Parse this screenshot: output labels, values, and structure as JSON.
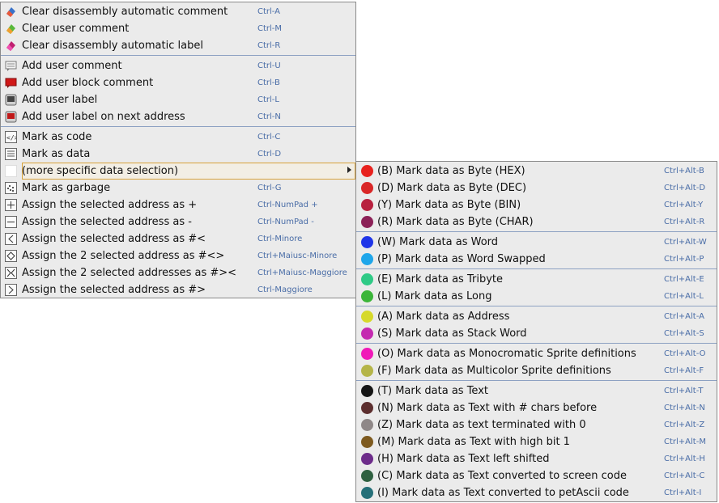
{
  "main_menu": {
    "items": [
      {
        "label": "Clear disassembly automatic comment",
        "shortcut": "Ctrl-A",
        "icon": "eraser-icon",
        "icon_colors": [
          "#e8593a",
          "#3a72c9"
        ]
      },
      {
        "label": "Clear user comment",
        "shortcut": "Ctrl-M",
        "icon": "eraser-icon",
        "icon_colors": [
          "#f0a030",
          "#58b83a"
        ]
      },
      {
        "label": "Clear disassembly automatic label",
        "shortcut": "Ctrl-R",
        "icon": "eraser-icon",
        "icon_colors": [
          "#e0309a",
          "#c02070"
        ]
      },
      {
        "label": "Add user comment",
        "shortcut": "Ctrl-U",
        "icon": "comment-icon",
        "icon_colors": [
          "#808080"
        ]
      },
      {
        "label": "Add user block comment",
        "shortcut": "Ctrl-B",
        "icon": "block-comment-icon",
        "icon_colors": [
          "#d01818"
        ]
      },
      {
        "label": "Add user label",
        "shortcut": "Ctrl-L",
        "icon": "label-icon",
        "icon_colors": [
          "#555555"
        ]
      },
      {
        "label": "Add user label on next address",
        "shortcut": "Ctrl-N",
        "icon": "next-label-icon",
        "icon_colors": [
          "#c01818"
        ]
      },
      {
        "label": "Mark as code",
        "shortcut": "Ctrl-C",
        "icon": "code-icon",
        "icon_colors": []
      },
      {
        "label": "Mark as data",
        "shortcut": "Ctrl-D",
        "icon": "data-icon",
        "icon_colors": []
      },
      {
        "label": "(more specific data selection)",
        "shortcut": "",
        "icon": "blank-icon",
        "icon_colors": []
      },
      {
        "label": "Mark as garbage",
        "shortcut": "Ctrl-G",
        "icon": "garbage-icon",
        "icon_colors": []
      },
      {
        "label": "Assign the selected address as +",
        "shortcut": "Ctrl-NumPad +",
        "icon": "plus-doc-icon",
        "icon_colors": []
      },
      {
        "label": "Assign the selected address as -",
        "shortcut": "Ctrl-NumPad -",
        "icon": "minus-doc-icon",
        "icon_colors": []
      },
      {
        "label": "Assign the selected address as #<",
        "shortcut": "Ctrl-Minore",
        "icon": "less-doc-icon",
        "icon_colors": []
      },
      {
        "label": "Assign the 2 selected address as #<>",
        "shortcut": "Ctrl+Maiusc-Minore",
        "icon": "diamond-doc-icon",
        "icon_colors": []
      },
      {
        "label": "Assign the 2 selected addresses as #><",
        "shortcut": "Ctrl+Maiusc-Maggiore",
        "icon": "cross-doc-icon",
        "icon_colors": []
      },
      {
        "label": "Assign the selected address as #>",
        "shortcut": "Ctrl-Maggiore",
        "icon": "greater-doc-icon",
        "icon_colors": []
      }
    ]
  },
  "sub_menu": {
    "items": [
      {
        "label": "(B) Mark data as Byte (HEX)",
        "shortcut": "Ctrl+Alt-B",
        "color": "#e8221e"
      },
      {
        "label": "(D) Mark data as Byte (DEC)",
        "shortcut": "Ctrl+Alt-D",
        "color": "#d92626"
      },
      {
        "label": "(Y) Mark data as Byte (BIN)",
        "shortcut": "Ctrl+Alt-Y",
        "color": "#b8213f"
      },
      {
        "label": "(R) Mark data as Byte (CHAR)",
        "shortcut": "Ctrl+Alt-R",
        "color": "#8c2157"
      },
      {
        "label": "(W) Mark data as Word",
        "shortcut": "Ctrl+Alt-W",
        "color": "#1f35e8"
      },
      {
        "label": "(P) Mark data as Word Swapped",
        "shortcut": "Ctrl+Alt-P",
        "color": "#1ea6ea"
      },
      {
        "label": "(E) Mark data as Tribyte",
        "shortcut": "Ctrl+Alt-E",
        "color": "#2fca86"
      },
      {
        "label": "(L) Mark data as Long",
        "shortcut": "Ctrl+Alt-L",
        "color": "#3bb539"
      },
      {
        "label": "(A) Mark data as Address",
        "shortcut": "Ctrl+Alt-A",
        "color": "#d6d92a"
      },
      {
        "label": "(S) Mark data as Stack Word",
        "shortcut": "Ctrl+Alt-S",
        "color": "#c42ab0"
      },
      {
        "label": "(O) Mark data as Monocromatic Sprite definitions",
        "shortcut": "Ctrl+Alt-O",
        "color": "#f01ab8"
      },
      {
        "label": "(F) Mark data as Multicolor Sprite definitions",
        "shortcut": "Ctrl+Alt-F",
        "color": "#b5b548"
      },
      {
        "label": "(T) Mark data as Text",
        "shortcut": "Ctrl+Alt-T",
        "color": "#151515"
      },
      {
        "label": "(N) Mark data as Text with # chars before",
        "shortcut": "Ctrl+Alt-N",
        "color": "#5c2e2e"
      },
      {
        "label": "(Z) Mark data as text terminated with 0",
        "shortcut": "Ctrl+Alt-Z",
        "color": "#8f8888"
      },
      {
        "label": "(M) Mark data as Text with high bit 1",
        "shortcut": "Ctrl+Alt-M",
        "color": "#7e5a1f"
      },
      {
        "label": "(H) Mark data as Text left shifted",
        "shortcut": "Ctrl+Alt-H",
        "color": "#6d2c8a"
      },
      {
        "label": "(C) Mark data as Text converted to screen code",
        "shortcut": "Ctrl+Alt-C",
        "color": "#2f6040"
      },
      {
        "label": "(I) Mark data as Text converted to petAscii code",
        "shortcut": "Ctrl+Alt-I",
        "color": "#256f78"
      }
    ]
  }
}
